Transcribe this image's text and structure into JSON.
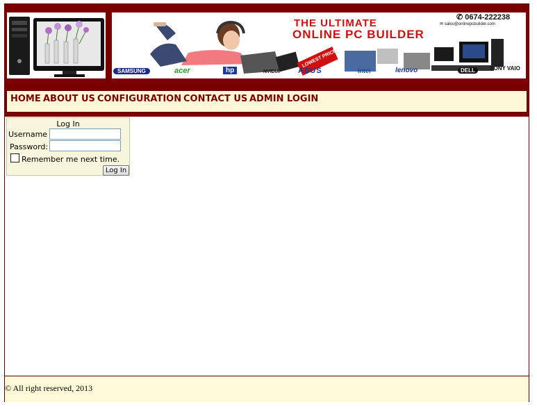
{
  "header": {
    "phone": "0674-222238",
    "email": "sales@onlinepcbuilder.com",
    "banner_line1": "THE ULTIMATE",
    "banner_line2": "ONLINE PC BUILDER",
    "badge": "LOWEST PRICE",
    "brands": [
      "SAMSUNG",
      "acer",
      "hp",
      "NVIDIA",
      "ASUS",
      "intel",
      "lenovo",
      "DELL",
      "SONY VAIO"
    ],
    "colors": {
      "brand_red": "#7a0000",
      "nav_bg": "#fff8d8",
      "banner_red": "#d01010"
    }
  },
  "nav": {
    "items": [
      "HOME",
      "ABOUT US",
      "CONFIGURATION",
      "CONTACT US",
      "ADMIN LOGIN"
    ]
  },
  "login": {
    "title": "Log In",
    "username_label": "Username",
    "password_label": "Password:",
    "username_value": "",
    "password_value": "",
    "remember_label": "Remember me next time.",
    "remember_checked": false,
    "button_label": "Log In"
  },
  "footer": {
    "text": "© All right reserved, 2013"
  }
}
